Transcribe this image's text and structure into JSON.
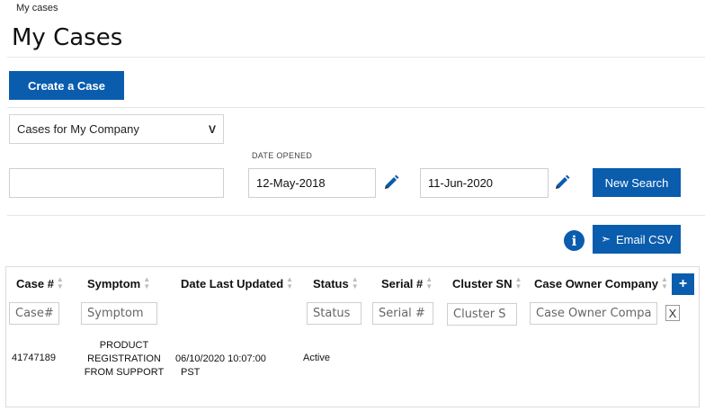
{
  "breadcrumb": "My cases",
  "page_title": "My Cases",
  "create_button": "Create a Case",
  "case_filter": {
    "selected": "Cases for My Company",
    "chevron": "V"
  },
  "search": {
    "value": ""
  },
  "date_opened": {
    "label": "DATE OPENED",
    "from": "12-May-2018",
    "to": "11-Jun-2020"
  },
  "new_search_button": "New Search",
  "info_icon": "i",
  "email_csv": {
    "label": "Email CSV",
    "icon": "➣"
  },
  "table": {
    "headers": [
      "Case #",
      "Symptom",
      "Date Last Updated",
      "Status",
      "Serial #",
      "Cluster SN",
      "Case Owner Company"
    ],
    "add_column": "+",
    "filters": [
      "Case#",
      "Symptom",
      "Status",
      "Serial #",
      "Cluster S",
      "Case Owner Compa"
    ],
    "clear_filters": "X",
    "rows": [
      {
        "case_number": "41747189",
        "symptom": [
          "PRODUCT",
          "REGISTRATION",
          "FROM SUPPORT"
        ],
        "date_last_updated": [
          "06/10/2020 10:07:00",
          "PST"
        ],
        "status": "Active",
        "serial": "",
        "cluster_sn": "",
        "owner_company": ""
      }
    ]
  },
  "colors": {
    "accent": "#0a5cad"
  }
}
